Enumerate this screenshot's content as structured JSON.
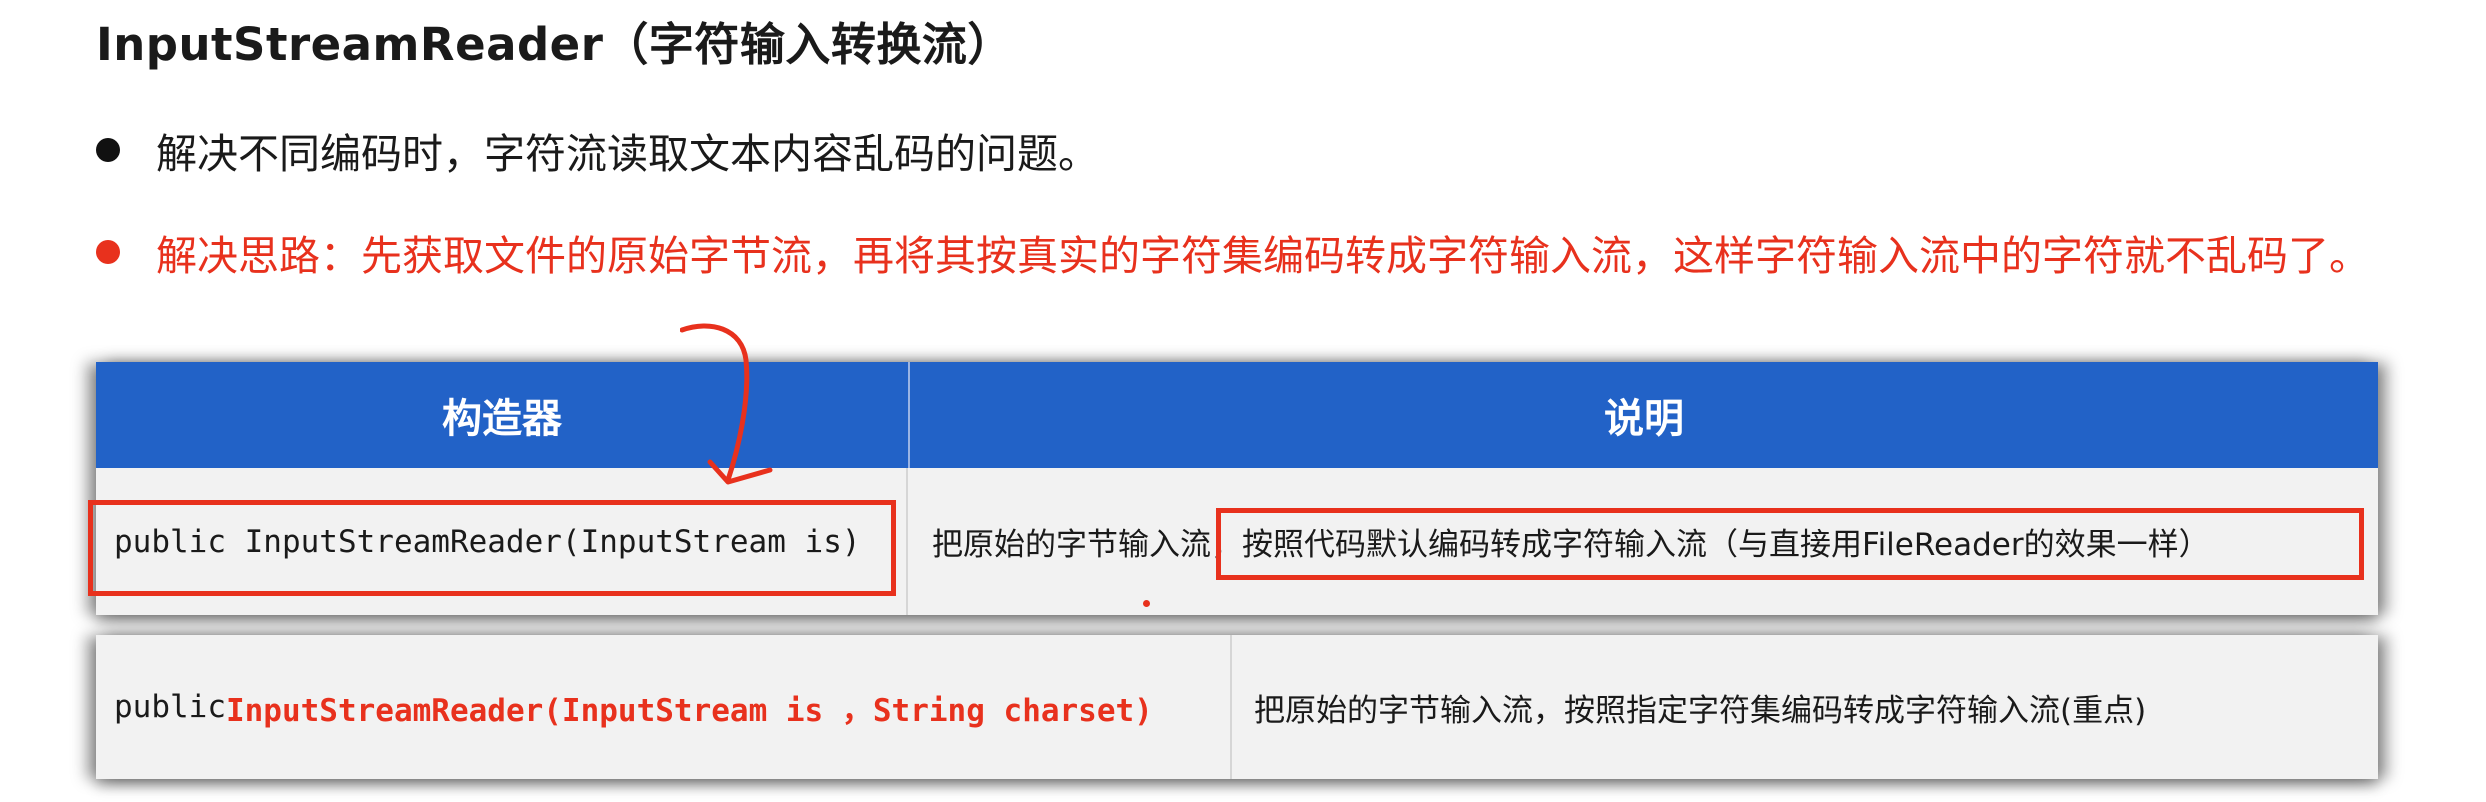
{
  "title": "InputStreamReader（字符输入转换流）",
  "bullets": [
    {
      "text": "解决不同编码时，字符流读取文本内容乱码的问题。",
      "color": "#1a1a1a"
    },
    {
      "text": "解决思路：先获取文件的原始字节流，再将其按真实的字符集编码转成字符输入流，这样字符输入流中的字符就不乱码了。",
      "color": "#e8311d"
    }
  ],
  "table": {
    "headers": [
      "构造器",
      "说明"
    ],
    "header_color": "#2262c7",
    "rows": [
      {
        "constructor": "public InputStreamReader(InputStream is)",
        "description": "把原始的字节输入流，按照代码默认编码转成字符输入流（与直接用FileReader的效果一样）"
      },
      {
        "constructor_prefix": "public ",
        "constructor_highlight": "InputStreamReader(InputStream is ，String charset)",
        "description": "把原始的字节输入流，按照指定字符集编码转成字符输入流(重点)"
      }
    ]
  },
  "annotation_color": "#e8311d"
}
